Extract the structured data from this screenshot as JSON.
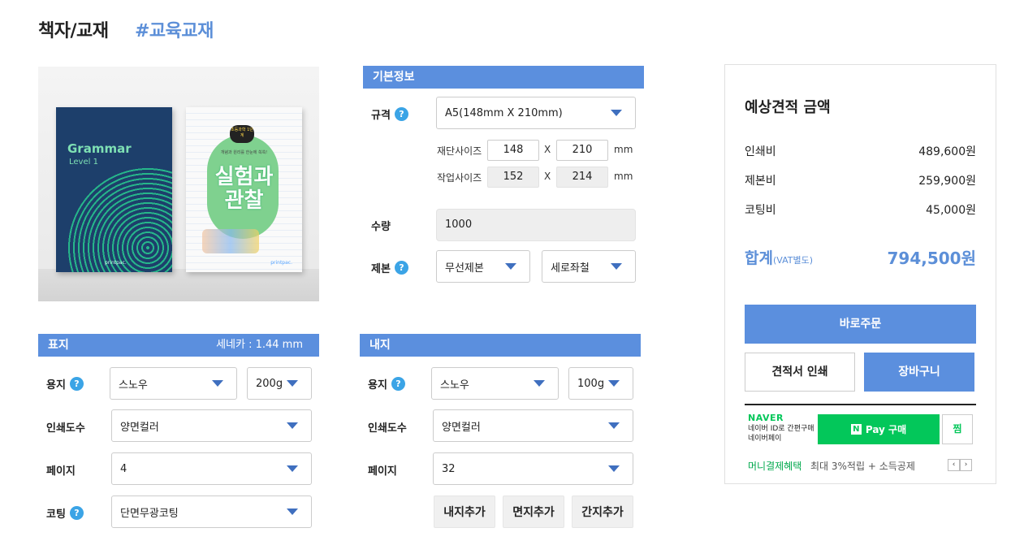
{
  "header": {
    "title": "책자/교재",
    "hashtag": "#교육교재"
  },
  "product_image": {
    "book1": {
      "title": "Grammar",
      "subtitle": "Level 1",
      "brand": "printpac."
    },
    "book2": {
      "badge": "초등과학 1단계",
      "subtitle": "개념과 원리를 한눈에 쏙쏙!",
      "title_line1": "실험과",
      "title_line2": "관찰",
      "brand": "printpac."
    }
  },
  "basic": {
    "section_label": "기본정보",
    "spec_label": "규격",
    "spec_value": "A5(148mm X 210mm)",
    "cut_size_label": "재단사이즈",
    "cut_w": "148",
    "cut_h": "210",
    "work_size_label": "작업사이즈",
    "work_w": "152",
    "work_h": "214",
    "x": "X",
    "unit": "mm",
    "qty_label": "수량",
    "qty_value": "1000",
    "binding_label": "제본",
    "binding_value": "무선제본",
    "binding_dir": "세로좌철"
  },
  "cover": {
    "section_label": "표지",
    "seneca": "세네카 : 1.44 mm",
    "paper_label": "용지",
    "paper_value": "스노우",
    "weight_value": "200g",
    "print_label": "인쇄도수",
    "print_value": "양면컬러",
    "page_label": "페이지",
    "page_value": "4",
    "coating_label": "코팅",
    "coating_value": "단면무광코팅"
  },
  "inner": {
    "section_label": "내지",
    "paper_label": "용지",
    "paper_value": "스노우",
    "weight_value": "100g",
    "print_label": "인쇄도수",
    "print_value": "양면컬러",
    "page_label": "페이지",
    "page_value": "32",
    "add_inner": "내지추가",
    "add_face": "면지추가",
    "add_insert": "간지추가"
  },
  "estimate": {
    "title": "예상견적 금액",
    "print_cost_label": "인쇄비",
    "print_cost": "489,600원",
    "binding_cost_label": "제본비",
    "binding_cost": "259,900원",
    "coating_cost_label": "코팅비",
    "coating_cost": "45,000원",
    "total_label": "합계",
    "total_note": "(VAT별도)",
    "total_value": "794,500원",
    "order_now": "바로주문",
    "print_quote": "견적서 인쇄",
    "cart": "장바구니"
  },
  "naver": {
    "logo": "NAVER",
    "text_line1": "네이버 ID로 간편구매",
    "text_line2": "네이버페이",
    "pay_n": "N",
    "pay_label": "Pay 구매",
    "jjim": "찜",
    "money_label": "머니결제혜택",
    "money_desc": "최대 3%적립 + 소득공제",
    "prev": "‹",
    "next": "›"
  },
  "colors": {
    "accent": "#5b8fde",
    "naver_green": "#03c75a",
    "help_icon": "#3ba4e6"
  }
}
